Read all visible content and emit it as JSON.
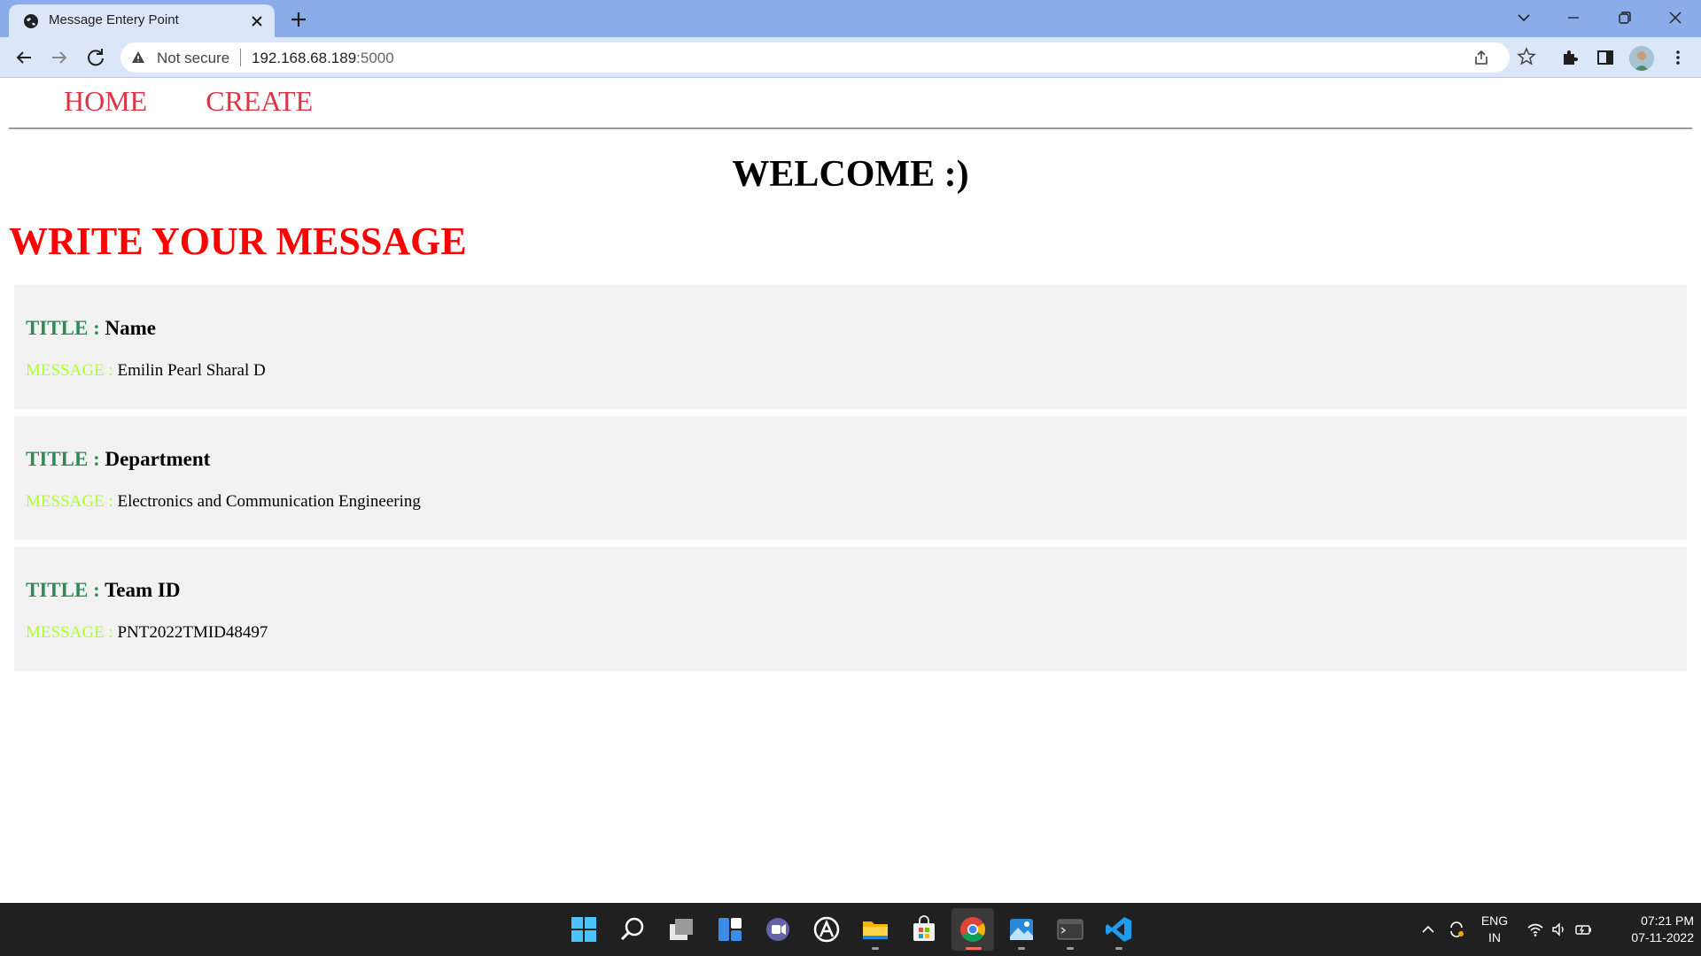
{
  "browser": {
    "tab_title": "Message Entery Point",
    "security_label": "Not secure",
    "url_host": "192.168.68.189",
    "url_port": ":5000"
  },
  "nav": {
    "home": "HOME",
    "create": "CREATE"
  },
  "page": {
    "welcome": "WELCOME :)",
    "heading": "WRITE YOUR MESSAGE"
  },
  "messages": [
    {
      "title_label": "TITLE : ",
      "title": "Name",
      "message_label": "MESSAGE : ",
      "message": "Emilin Pearl Sharal D"
    },
    {
      "title_label": "TITLE : ",
      "title": "Department",
      "message_label": "MESSAGE : ",
      "message": "Electronics and Communication Engineering"
    },
    {
      "title_label": "TITLE : ",
      "title": "Team ID",
      "message_label": "MESSAGE : ",
      "message": "PNT2022TMID48497"
    }
  ],
  "taskbar": {
    "apps": [
      "start-icon",
      "search-icon",
      "task-view-icon",
      "widgets-icon",
      "teams-chat-icon",
      "app-icon",
      "file-explorer-icon",
      "store-icon",
      "chrome-icon",
      "photos-icon",
      "terminal-icon",
      "vscode-icon"
    ],
    "language": "ENG",
    "region": "IN",
    "time": "07:21 PM",
    "date": "07-11-2022"
  },
  "colors": {
    "nav_link": "#dc3545",
    "heading": "#ff0000",
    "title_label": "#2e8b57",
    "message_label": "#adff2f",
    "card_bg": "#f2f2f2"
  }
}
